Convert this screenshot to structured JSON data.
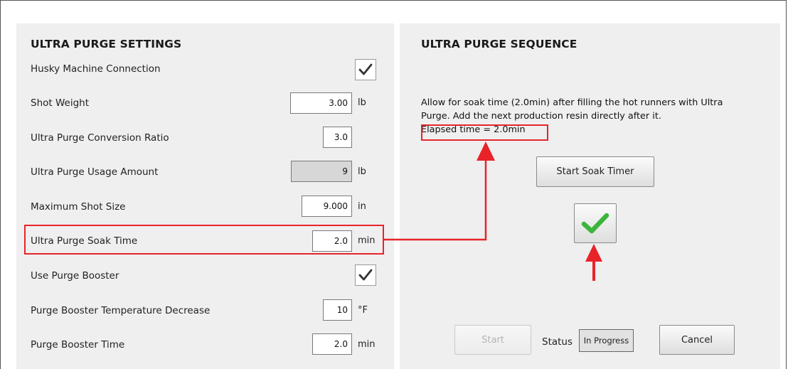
{
  "settings": {
    "title": "ULTRA PURGE SETTINGS",
    "rows": [
      {
        "label": "Husky Machine Connection",
        "checked": true
      },
      {
        "label": "Shot Weight",
        "value": "3.00",
        "unit": "lb"
      },
      {
        "label": "Ultra Purge Conversion Ratio",
        "value": "3.0"
      },
      {
        "label": "Ultra Purge Usage Amount",
        "value": "9",
        "unit": "lb",
        "readonly": true
      },
      {
        "label": "Maximum Shot Size",
        "value": "9.000",
        "unit": "in"
      },
      {
        "label": "Ultra Purge Soak Time",
        "value": "2.0",
        "unit": "min",
        "highlighted": true
      },
      {
        "label": "Use Purge Booster",
        "checked": true
      },
      {
        "label": "Purge Booster Temperature Decrease",
        "value": "10",
        "unit": "°F"
      },
      {
        "label": "Purge Booster Time",
        "value": "2.0",
        "unit": "min"
      }
    ]
  },
  "sequence": {
    "title": "ULTRA PURGE SEQUENCE",
    "instruction_line1": "Allow for soak time (2.0min) after filling the hot runners with Ultra",
    "instruction_line2": "Purge. Add the next production resin directly after it.",
    "elapsed": "Elapsed time = 2.0min",
    "start_soak_timer_label": "Start Soak Timer",
    "soak_complete_icon": "green-checkmark-icon",
    "start_label": "Start",
    "status_label": "Status",
    "status_value": "In Progress",
    "cancel_label": "Cancel"
  },
  "colors": {
    "highlight": "#e8242a",
    "panel_bg": "#efefef",
    "check_green": "#3cb53c"
  }
}
